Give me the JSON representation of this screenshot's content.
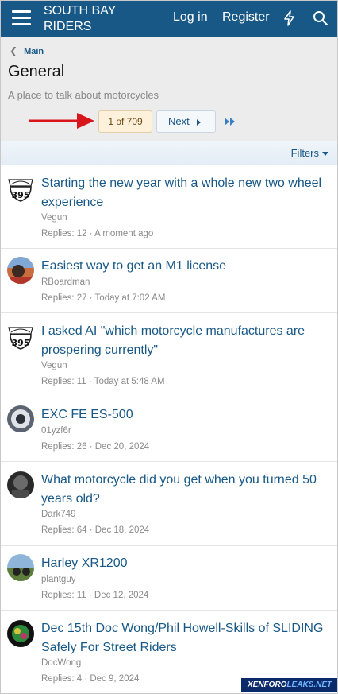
{
  "header": {
    "logo_line1": "SOUTH BAY",
    "logo_line2": "RIDERS",
    "login": "Log in",
    "register": "Register",
    "bg_color": "#185886"
  },
  "breadcrumb": {
    "label": "Main"
  },
  "forum": {
    "title": "General",
    "description": "A place to talk about motorcycles"
  },
  "pagination": {
    "current": "1 of 709",
    "next": "Next"
  },
  "filters": {
    "label": "Filters"
  },
  "threads": [
    {
      "title": "Starting the new year with a whole new two wheel experience",
      "author": "Vegun",
      "meta": "Replies: 12 · A moment ago",
      "avatar": "395"
    },
    {
      "title": "Easiest way to get an M1 license",
      "author": "RBoardman",
      "meta": "Replies: 27 · Today at 7:02 AM",
      "avatar": "photo"
    },
    {
      "title": "I asked AI \"which motorcycle manufactures are prospering currently\"",
      "author": "Vegun",
      "meta": "Replies: 11 · Today at 5:48 AM",
      "avatar": "395"
    },
    {
      "title": "EXC FE ES-500",
      "author": "01yzf6r",
      "meta": "Replies: 26 · Dec 20, 2024",
      "avatar": "photo"
    },
    {
      "title": "What motorcycle did you get when you turned 50 years old?",
      "author": "Dark749",
      "meta": "Replies: 64 · Dec 18, 2024",
      "avatar": "photo"
    },
    {
      "title": "Harley XR1200",
      "author": "plantguy",
      "meta": "Replies: 11 · Dec 12, 2024",
      "avatar": "photo"
    },
    {
      "title": "Dec 15th Doc Wong/Phil Howell-Skills of SLIDING Safely For Street Riders",
      "author": "DocWong",
      "meta": "Replies: 4 · Dec 9, 2024",
      "avatar": "photo"
    }
  ],
  "watermark": {
    "part1": "XENFORO",
    "part2": "LEAKS.NET"
  }
}
